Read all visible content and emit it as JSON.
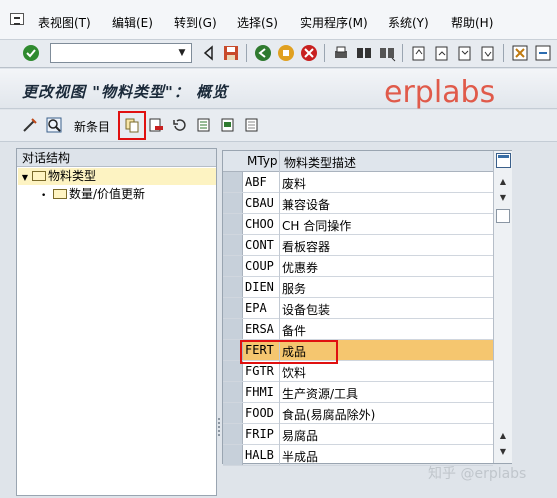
{
  "menu": [
    "表视图(T)",
    "编辑(E)",
    "转到(G)",
    "选择(S)",
    "实用程序(M)",
    "系统(Y)",
    "帮助(H)"
  ],
  "command_field": {
    "value": ""
  },
  "title": "更改视图 \"物料类型\"： 概览",
  "watermark": "erplabs",
  "app_toolbar": {
    "new_entries": "新条目"
  },
  "left_panel": {
    "header": "对话结构",
    "nodes": [
      {
        "label": "物料类型",
        "expanded": true
      },
      {
        "label": "数量/价值更新"
      }
    ]
  },
  "table": {
    "columns": [
      "MTyp",
      "物料类型描述"
    ],
    "rows": [
      {
        "code": "ABF",
        "desc": "废料"
      },
      {
        "code": "CBAU",
        "desc": "兼容设备"
      },
      {
        "code": "CHOO",
        "desc": "CH 合同操作"
      },
      {
        "code": "CONT",
        "desc": "看板容器"
      },
      {
        "code": "COUP",
        "desc": "优惠券"
      },
      {
        "code": "DIEN",
        "desc": "服务"
      },
      {
        "code": "EPA",
        "desc": "设备包装"
      },
      {
        "code": "ERSA",
        "desc": "备件"
      },
      {
        "code": "FERT",
        "desc": "成品",
        "highlighted": true
      },
      {
        "code": "FGTR",
        "desc": "饮料"
      },
      {
        "code": "FHMI",
        "desc": "生产资源/工具"
      },
      {
        "code": "FOOD",
        "desc": "食品(易腐品除外)"
      },
      {
        "code": "FRIP",
        "desc": "易腐品"
      },
      {
        "code": "HALB",
        "desc": "半成品"
      }
    ]
  },
  "footer_watermark": "知乎 @erplabs",
  "colors": {
    "highlight_row": "#f5c66f",
    "red_box": "#e01010",
    "watermark": "#e05a4a"
  }
}
